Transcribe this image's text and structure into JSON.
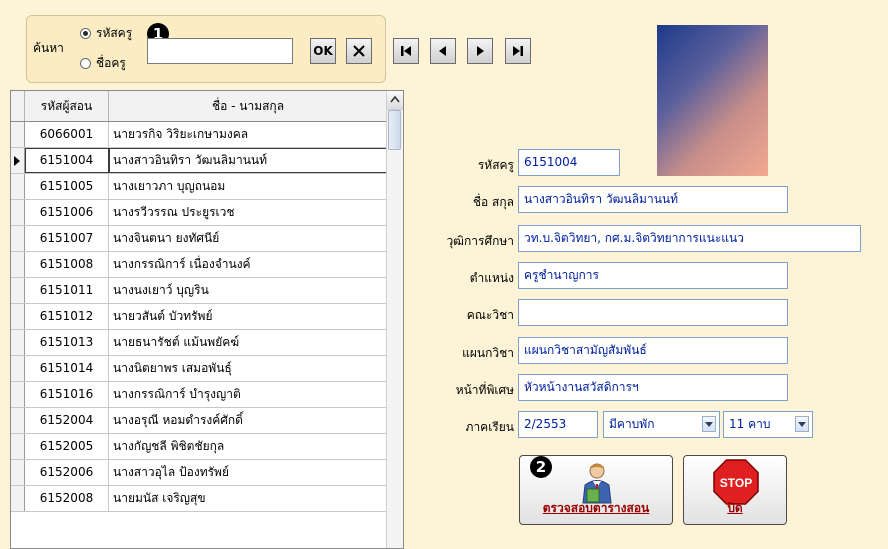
{
  "search": {
    "label": "ค้นหา",
    "options": [
      {
        "label": "รหัสครู",
        "selected": true
      },
      {
        "label": "ชื่อครู",
        "selected": false
      }
    ],
    "callout_1": "1",
    "input_value": "",
    "ok_label": "OK",
    "clear_icon": "x-icon",
    "nav_icons": [
      "first-record-icon",
      "previous-record-icon",
      "next-record-icon",
      "last-record-icon"
    ]
  },
  "grid": {
    "columns": [
      "รหัสผู้สอน",
      "ชื่อ - นามสกุล"
    ],
    "current_index": 1,
    "rows": [
      [
        "6066001",
        "นายวรกิจ วิริยะเกษามงคล"
      ],
      [
        "6151004",
        "นางสาวอินทิรา วัฒนลิมานนท์"
      ],
      [
        "6151005",
        "นางเยาวภา บุญถนอม"
      ],
      [
        "6151006",
        "นางรวีวรรณ ประยูรเวช"
      ],
      [
        "6151007",
        "นางจินตนา ยงทัศนีย์"
      ],
      [
        "6151008",
        "นางกรรณิการ์ เนื่องจำนงค์"
      ],
      [
        "6151011",
        "นางนงเยาว์ บุญริน"
      ],
      [
        "6151012",
        "นายวสันต์ บัวทรัพย์"
      ],
      [
        "6151013",
        "นายธนารัชต์ แม้นพยัคฆ์"
      ],
      [
        "6151014",
        "นางนิตยาพร เสมอพันธุ์"
      ],
      [
        "6151016",
        "นางกรรณิการ์ บำรุงญาติ"
      ],
      [
        "6152004",
        "นางอรุณี หอมดำรงค์ศักดิ์"
      ],
      [
        "6152005",
        "นางกัญชลี พิชิตชัยกุล"
      ],
      [
        "6152006",
        "นางสาวอุไล ป้องทรัพย์"
      ],
      [
        "6152008",
        "นายมนัส เจริญสุข"
      ]
    ]
  },
  "form": {
    "teacher_code_label": "รหัสครู",
    "teacher_code": "6151004",
    "name_label": "ชื่อ สกุล",
    "name": "นางสาวอินทิรา วัฒนลิมานนท์",
    "education_label": "วุฒิการศึกษา",
    "education": "วท.บ.จิตวิทยา, กศ.ม.จิตวิทยาการแนะแนว",
    "position_label": "ตำแหน่ง",
    "position": "ครูชำนาญการ",
    "faculty_label": "คณะวิชา",
    "faculty": "",
    "department_label": "แผนกวิชา",
    "department": "แผนกวิชาสามัญสัมพันธ์",
    "special_duty_label": "หน้าที่พิเศษ",
    "special_duty": "หัวหน้างานสวัสดิการฯ",
    "semester_label": "ภาคเรียน",
    "semester": "2/2553",
    "break_option": "มีคาบพัก",
    "periods": "11 คาบ"
  },
  "buttons": {
    "callout_2": "2",
    "check_schedule_label": "ตรวจสอบตารางสอน",
    "check_schedule_icon": "teacher-icon",
    "close_label": "ปิด",
    "stop_sign_text": "STOP",
    "close_icon": "stop-sign-icon"
  },
  "colors": {
    "background": "#fdf3d6",
    "field_text": "#00209f",
    "button_caption": "#9b0000"
  }
}
